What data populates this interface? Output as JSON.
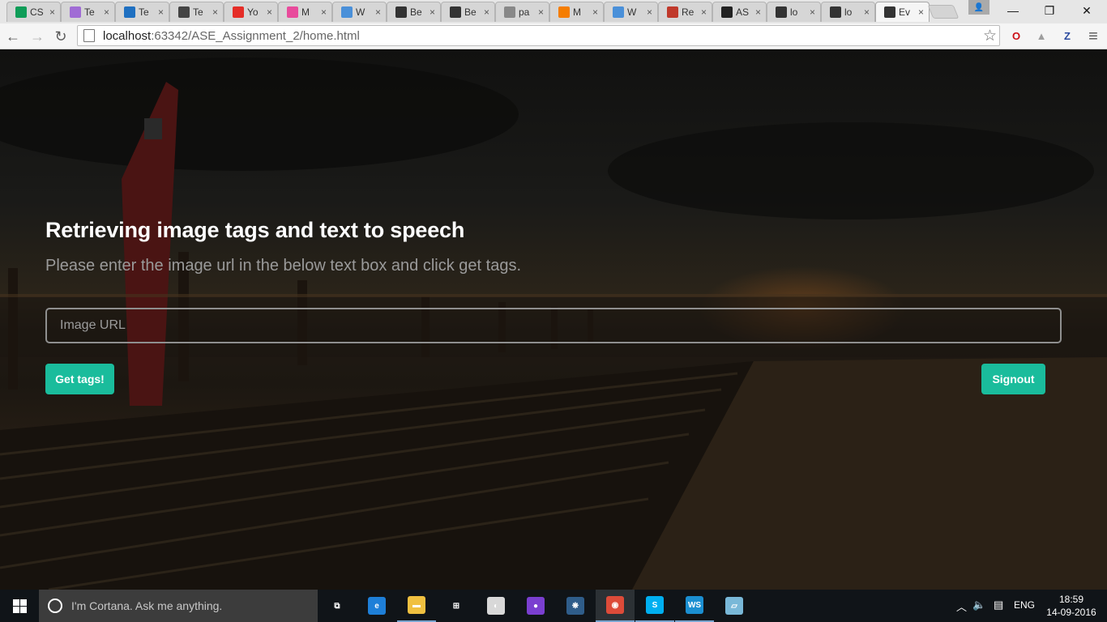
{
  "browser": {
    "tabs": [
      {
        "title": "CS",
        "favicon": "sheets-icon",
        "color": "#0f9d58"
      },
      {
        "title": "Te",
        "favicon": "purple-circle-icon",
        "color": "#a06cd5"
      },
      {
        "title": "Te",
        "favicon": "ibm-icon",
        "color": "#1f70c1"
      },
      {
        "title": "Te",
        "favicon": "network-icon",
        "color": "#444444"
      },
      {
        "title": "Yo",
        "favicon": "youtube-icon",
        "color": "#e52d27"
      },
      {
        "title": "M",
        "favicon": "refresh-pink-icon",
        "color": "#e84b9c"
      },
      {
        "title": "W",
        "favicon": "gear-blue-icon",
        "color": "#4a90d9"
      },
      {
        "title": "Be",
        "favicon": "codepen-icon",
        "color": "#333333"
      },
      {
        "title": "Be",
        "favicon": "codepen-icon",
        "color": "#333333"
      },
      {
        "title": "pa",
        "favicon": "page-icon",
        "color": "#888888"
      },
      {
        "title": "M",
        "favicon": "blogger-icon",
        "color": "#f57d00"
      },
      {
        "title": "W",
        "favicon": "gear-blue-icon",
        "color": "#4a90d9"
      },
      {
        "title": "Re",
        "favicon": "shield-red-icon",
        "color": "#c0392b"
      },
      {
        "title": "AS",
        "favicon": "github-icon",
        "color": "#222222"
      },
      {
        "title": "lo",
        "favicon": "webstorm-icon",
        "color": "#333333"
      },
      {
        "title": "lo",
        "favicon": "webstorm-icon",
        "color": "#333333"
      },
      {
        "title": "Ev",
        "favicon": "webstorm-icon",
        "color": "#333333"
      }
    ],
    "close_glyph": "×",
    "window_controls": {
      "minimize": "—",
      "restore": "❐",
      "close": "✕"
    },
    "url_host": "localhost",
    "url_rest": ":63342/ASE_Assignment_2/home.html",
    "extensions": [
      {
        "icon": "opera-icon",
        "glyph": "O",
        "color": "#cc0f16"
      },
      {
        "icon": "drive-icon",
        "glyph": "▲",
        "color": "#9e9e9e"
      },
      {
        "icon": "zotero-icon",
        "glyph": "Z",
        "color": "#2b4a9f"
      }
    ]
  },
  "page": {
    "title": "Retrieving image tags and text to speech",
    "subtitle": "Please enter the image url in the below text box and click get tags.",
    "input_placeholder": "Image URL",
    "get_tags_label": "Get tags!",
    "signout_label": "Signout",
    "accent_color": "#1abc9c"
  },
  "taskbar": {
    "cortana_placeholder": "I'm Cortana. Ask me anything.",
    "apps": [
      {
        "name": "task-view-icon",
        "glyph": "⧉",
        "color": "transparent"
      },
      {
        "name": "edge-icon",
        "glyph": "e",
        "color": "#1e7fd8"
      },
      {
        "name": "file-explorer-icon",
        "glyph": "▬",
        "color": "#f0c040"
      },
      {
        "name": "store-icon",
        "glyph": "⊞",
        "color": "transparent"
      },
      {
        "name": "compass-icon",
        "glyph": "◐",
        "color": "#d8d8d8"
      },
      {
        "name": "cat-app-icon",
        "glyph": "●",
        "color": "#7a3fd0"
      },
      {
        "name": "tree-app-icon",
        "glyph": "❋",
        "color": "#2f5d8a"
      },
      {
        "name": "chrome-icon",
        "glyph": "◉",
        "color": "#dd4b39"
      },
      {
        "name": "skype-icon",
        "glyph": "S",
        "color": "#00aff0"
      },
      {
        "name": "webstorm-icon",
        "glyph": "WS",
        "color": "#1b8fd1"
      },
      {
        "name": "notepad-icon",
        "glyph": "▱",
        "color": "#79b8d8"
      }
    ],
    "language": "ENG",
    "time": "18:59",
    "date": "14-09-2016"
  }
}
